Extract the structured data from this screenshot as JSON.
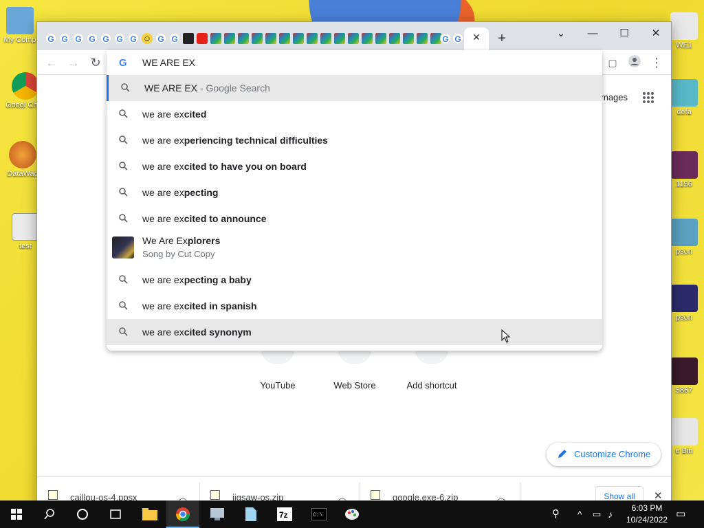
{
  "desktop": {
    "icons_left": [
      {
        "label": "My Comp",
        "color": "#6aa7d6"
      },
      {
        "label": "Googl Chrom",
        "color": "#db4437"
      },
      {
        "label": "DataWag",
        "color": "#e07b2a"
      },
      {
        "label": "test",
        "color": "#dddddd"
      }
    ],
    "icons_right": [
      {
        "label": "WE1",
        "color": "#dcdcdc"
      },
      {
        "label": "defa",
        "color": "#58b8c8"
      },
      {
        "label": "1156",
        "color": "#6a2a5a"
      },
      {
        "label": "pson",
        "color": "#5aa0c0"
      },
      {
        "label": "pson",
        "color": "#2a2a6a"
      },
      {
        "label": "5867",
        "color": "#3a1a2a"
      },
      {
        "label": "e Bin",
        "color": "#dddddd"
      }
    ]
  },
  "browser": {
    "omnibox": {
      "value": "WE ARE EX",
      "suggestions": [
        {
          "plain": "WE ARE EX",
          "bold": "",
          "suffix": " - Google Search",
          "highlighted": true
        },
        {
          "plain": "we are ex",
          "bold": "cited"
        },
        {
          "plain": "we are ex",
          "bold": "periencing technical difficulties"
        },
        {
          "plain": "we are ex",
          "bold": "cited to have you on board"
        },
        {
          "plain": "we are ex",
          "bold": "pecting"
        },
        {
          "plain": "we are ex",
          "bold": "cited to announce"
        }
      ],
      "rich_suggestion": {
        "title_plain": "We Are Ex",
        "title_bold": "plorers",
        "subtitle": "Song by Cut Copy"
      },
      "suggestions_after": [
        {
          "plain": "we are ex",
          "bold": "pecting a baby"
        },
        {
          "plain": "we are ex",
          "bold": "cited in spanish"
        },
        {
          "plain": "we are ex",
          "bold": "cited synonym",
          "hovered": true
        }
      ]
    },
    "page": {
      "images_link": "mages",
      "shortcuts": [
        {
          "label": "YouTube",
          "color": "#e62117"
        },
        {
          "label": "Web Store",
          "color": "#4285f4"
        },
        {
          "label": "Add shortcut",
          "color": "#5f6368"
        }
      ],
      "customize_label": "Customize Chrome"
    },
    "downloads": {
      "items": [
        "caillou-os-4.ppsx",
        "jigsaw-os.zip",
        "google.exe-6.zip"
      ],
      "show_all_label": "Show all"
    }
  },
  "taskbar": {
    "time": "6:03 PM",
    "date": "10/24/2022"
  }
}
